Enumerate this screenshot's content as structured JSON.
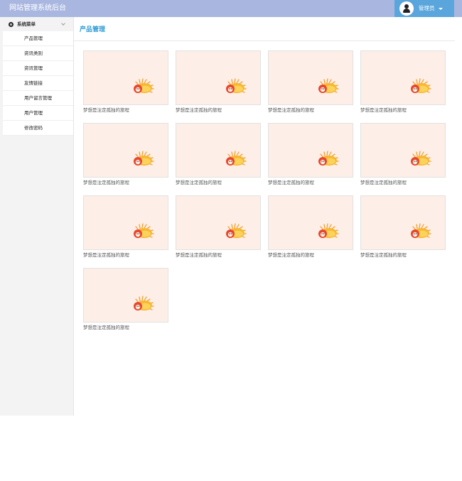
{
  "header": {
    "site_title": "网站管理系统后台",
    "user_name": "管理员"
  },
  "sidebar": {
    "menu_title": "系统菜单",
    "items": [
      {
        "label": "产品管理"
      },
      {
        "label": "资讯类别"
      },
      {
        "label": "资讯管理"
      },
      {
        "label": "友情链接"
      },
      {
        "label": "用户留言管理"
      },
      {
        "label": "用户管理"
      },
      {
        "label": "修改密码"
      }
    ]
  },
  "main": {
    "page_title": "产品管理",
    "products": [
      {
        "caption": "梦想是注定孤独的旅程"
      },
      {
        "caption": "梦想是注定孤独的旅程"
      },
      {
        "caption": "梦想是注定孤独的旅程"
      },
      {
        "caption": "梦想是注定孤独的旅程"
      },
      {
        "caption": "梦想是注定孤独的旅程"
      },
      {
        "caption": "梦想是注定孤独的旅程"
      },
      {
        "caption": "梦想是注定孤独的旅程"
      },
      {
        "caption": "梦想是注定孤独的旅程"
      },
      {
        "caption": "梦想是注定孤独的旅程"
      },
      {
        "caption": "梦想是注定孤独的旅程"
      },
      {
        "caption": "梦想是注定孤独的旅程"
      },
      {
        "caption": "梦想是注定孤独的旅程"
      },
      {
        "caption": "梦想是注定孤独的旅程"
      }
    ]
  },
  "colors": {
    "header_bg": "#a9b7e0",
    "user_area_bg": "#5aa5dc",
    "title_accent": "#2f9bd6",
    "thumb_bg": "#fdeee7"
  }
}
